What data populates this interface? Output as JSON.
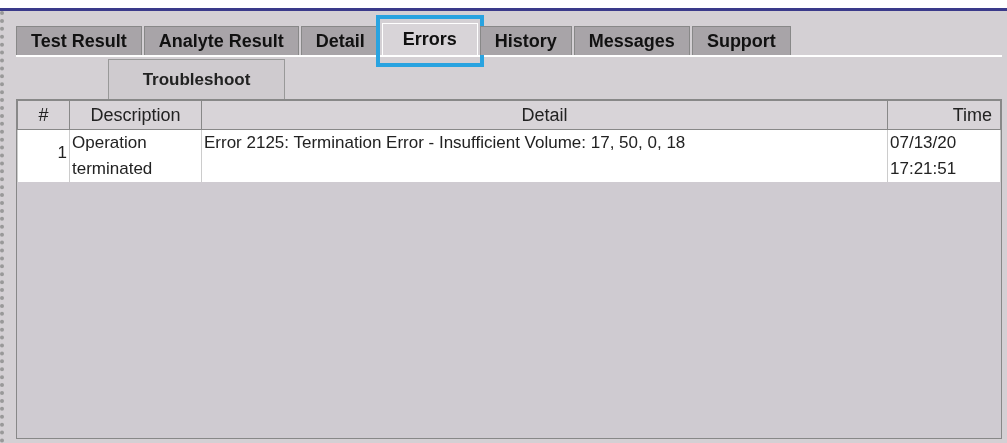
{
  "tabs": [
    {
      "label": "Test Result",
      "selected": false,
      "highlighted": false
    },
    {
      "label": "Analyte Result",
      "selected": false,
      "highlighted": false
    },
    {
      "label": "Detail",
      "selected": false,
      "highlighted": false
    },
    {
      "label": "Errors",
      "selected": true,
      "highlighted": true
    },
    {
      "label": "History",
      "selected": false,
      "highlighted": false
    },
    {
      "label": "Messages",
      "selected": false,
      "highlighted": false
    },
    {
      "label": "Support",
      "selected": false,
      "highlighted": false
    }
  ],
  "troubleshoot_button": "Troubleshoot",
  "table": {
    "columns": [
      "#",
      "Description",
      "Detail",
      "Time"
    ],
    "rows": [
      {
        "cells": [
          "1",
          "Operation terminated",
          "Error 2125: Termination Error - Insufficient Volume: 17, 50, 0, 18",
          "07/13/20 17:21:51"
        ]
      }
    ]
  }
}
